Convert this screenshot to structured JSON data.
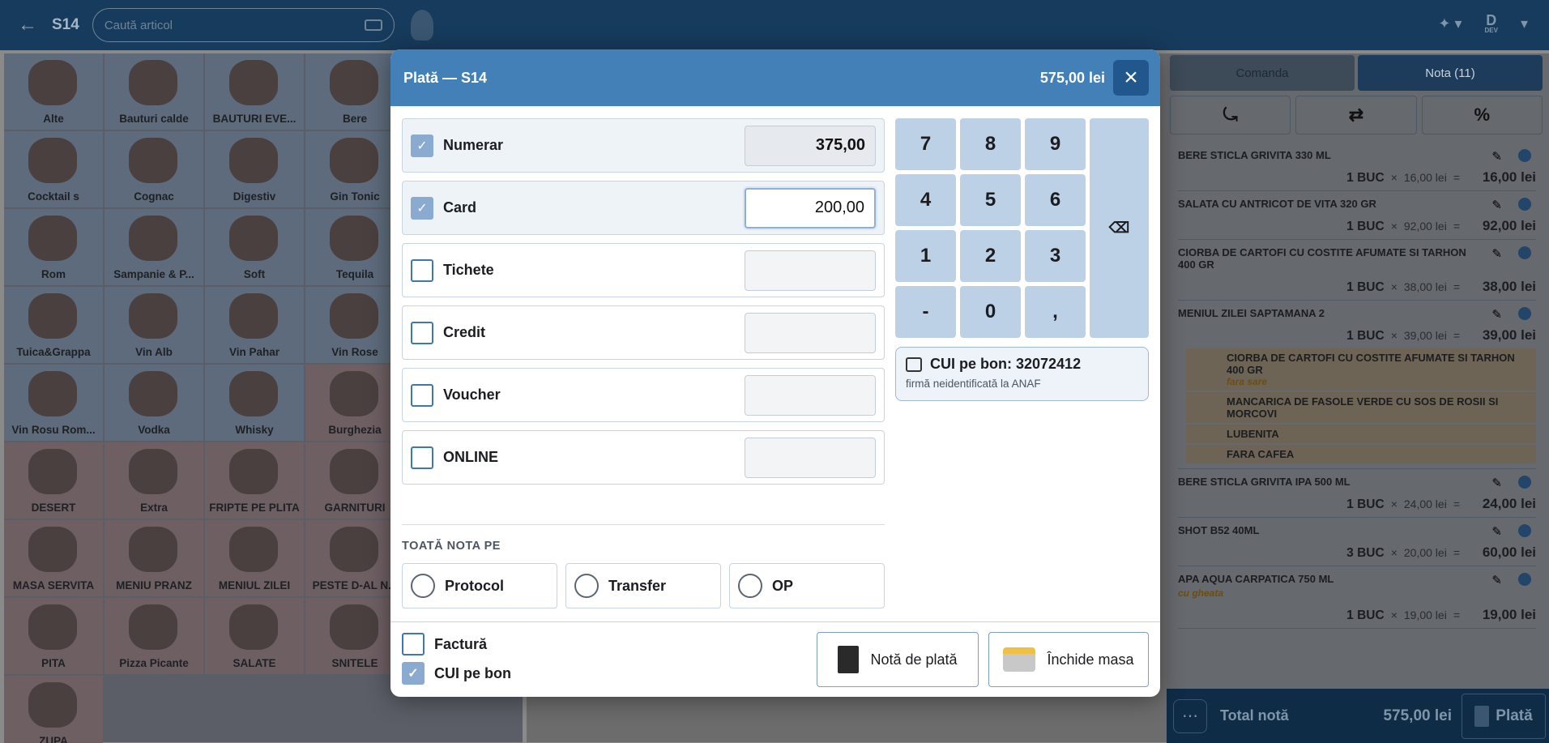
{
  "topbar": {
    "back_icon": "arrow-left-icon",
    "table_name": "S14",
    "search_placeholder": "Caută articol",
    "user_initial": "D",
    "user_sub": "DEV"
  },
  "categories": [
    {
      "label": "Alte",
      "tint": "blue"
    },
    {
      "label": "Bauturi calde",
      "tint": "blue"
    },
    {
      "label": "BAUTURI EVE...",
      "tint": "blue"
    },
    {
      "label": "Bere",
      "tint": "blue"
    },
    {
      "label": "Cocktail s",
      "tint": "blue"
    },
    {
      "label": "Cognac",
      "tint": "blue"
    },
    {
      "label": "Digestiv",
      "tint": "blue"
    },
    {
      "label": "Gin Tonic",
      "tint": "blue"
    },
    {
      "label": "Rom",
      "tint": "blue"
    },
    {
      "label": "Sampanie & P...",
      "tint": "blue"
    },
    {
      "label": "Soft",
      "tint": "blue"
    },
    {
      "label": "Tequila",
      "tint": "blue"
    },
    {
      "label": "Tuica&Grappa",
      "tint": "blue"
    },
    {
      "label": "Vin Alb",
      "tint": "blue"
    },
    {
      "label": "Vin Pahar",
      "tint": "blue"
    },
    {
      "label": "Vin Rose",
      "tint": "blue"
    },
    {
      "label": "Vin Rosu Rom...",
      "tint": "blue"
    },
    {
      "label": "Vodka",
      "tint": "blue"
    },
    {
      "label": "Whisky",
      "tint": "blue"
    },
    {
      "label": "Burghezia",
      "tint": "pink"
    },
    {
      "label": "DESERT",
      "tint": "pink"
    },
    {
      "label": "Extra",
      "tint": "pink"
    },
    {
      "label": "FRIPTE PE PLITA",
      "tint": "pink"
    },
    {
      "label": "GARNITURI",
      "tint": "pink"
    },
    {
      "label": "MASA SERVITA",
      "tint": "pink"
    },
    {
      "label": "MENIU PRANZ",
      "tint": "pink"
    },
    {
      "label": "MENIUL ZILEI",
      "tint": "pink"
    },
    {
      "label": "PESTE D-AL N...",
      "tint": "pink"
    },
    {
      "label": "PITA",
      "tint": "pink"
    },
    {
      "label": "Pizza Picante",
      "tint": "pink"
    },
    {
      "label": "SALATE",
      "tint": "pink"
    },
    {
      "label": "SNITELE",
      "tint": "pink"
    },
    {
      "label": "ZUPA",
      "tint": "pink"
    }
  ],
  "right": {
    "tab_order": "Comanda",
    "tab_bill": "Nota (11)",
    "items": [
      {
        "name": "BERE STICLA GRIVITA 330 ML",
        "qty": "1 BUC",
        "unit": "16,00 lei",
        "total": "16,00 lei",
        "subs": []
      },
      {
        "name": "SALATA CU ANTRICOT DE VITA 320 GR",
        "qty": "1 BUC",
        "unit": "92,00 lei",
        "total": "92,00 lei",
        "subs": []
      },
      {
        "name": "CIORBA DE CARTOFI CU COSTITE AFUMATE SI TARHON 400 GR",
        "qty": "1 BUC",
        "unit": "38,00 lei",
        "total": "38,00 lei",
        "subs": []
      },
      {
        "name": "MENIUL ZILEI SAPTAMANA 2",
        "qty": "1 BUC",
        "unit": "39,00 lei",
        "total": "39,00 lei",
        "subs": [
          {
            "name": "CIORBA DE CARTOFI CU COSTITE AFUMATE SI TARHON 400 GR",
            "note": "fara sare"
          },
          {
            "name": "MANCARICA DE FASOLE VERDE CU SOS DE ROSII SI MORCOVI",
            "note": ""
          },
          {
            "name": "LUBENITA",
            "note": ""
          },
          {
            "name": "FARA CAFEA",
            "note": ""
          }
        ]
      },
      {
        "name": "BERE STICLA GRIVITA IPA 500 ML",
        "qty": "1 BUC",
        "unit": "24,00 lei",
        "total": "24,00 lei",
        "subs": []
      },
      {
        "name": "SHOT B52 40ML",
        "qty": "3 BUC",
        "unit": "20,00 lei",
        "total": "60,00 lei",
        "subs": []
      },
      {
        "name": "APA AQUA CARPATICA 750 ML",
        "note": "cu gheata",
        "qty": "1 BUC",
        "unit": "19,00 lei",
        "total": "19,00 lei",
        "subs": []
      }
    ],
    "footer_label": "Total notă",
    "footer_value": "575,00 lei",
    "pay_label": "Plată"
  },
  "modal": {
    "title": "Plată — S14",
    "total": "575,00 lei",
    "methods": [
      {
        "label": "Numerar",
        "value": "375,00",
        "checked": true
      },
      {
        "label": "Card",
        "value": "200,00",
        "checked": true
      },
      {
        "label": "Tichete",
        "value": "",
        "checked": false
      },
      {
        "label": "Credit",
        "value": "",
        "checked": false
      },
      {
        "label": "Voucher",
        "value": "",
        "checked": false
      },
      {
        "label": "ONLINE",
        "value": "",
        "checked": false
      }
    ],
    "whole_bill_title": "TOATĂ NOTA PE",
    "whole_bill_options": [
      "Protocol",
      "Transfer",
      "OP"
    ],
    "numpad": [
      "7",
      "8",
      "9",
      "4",
      "5",
      "6",
      "1",
      "2",
      "3",
      "-",
      "0",
      ","
    ],
    "cui_title": "CUI pe bon: 32072412",
    "cui_sub": "firmă neidentificată la ANAF",
    "factura_label": "Factură",
    "cui_checkbox_label": "CUI pe bon",
    "bill_button": "Notă de plată",
    "close_table_button": "Închide masa"
  }
}
